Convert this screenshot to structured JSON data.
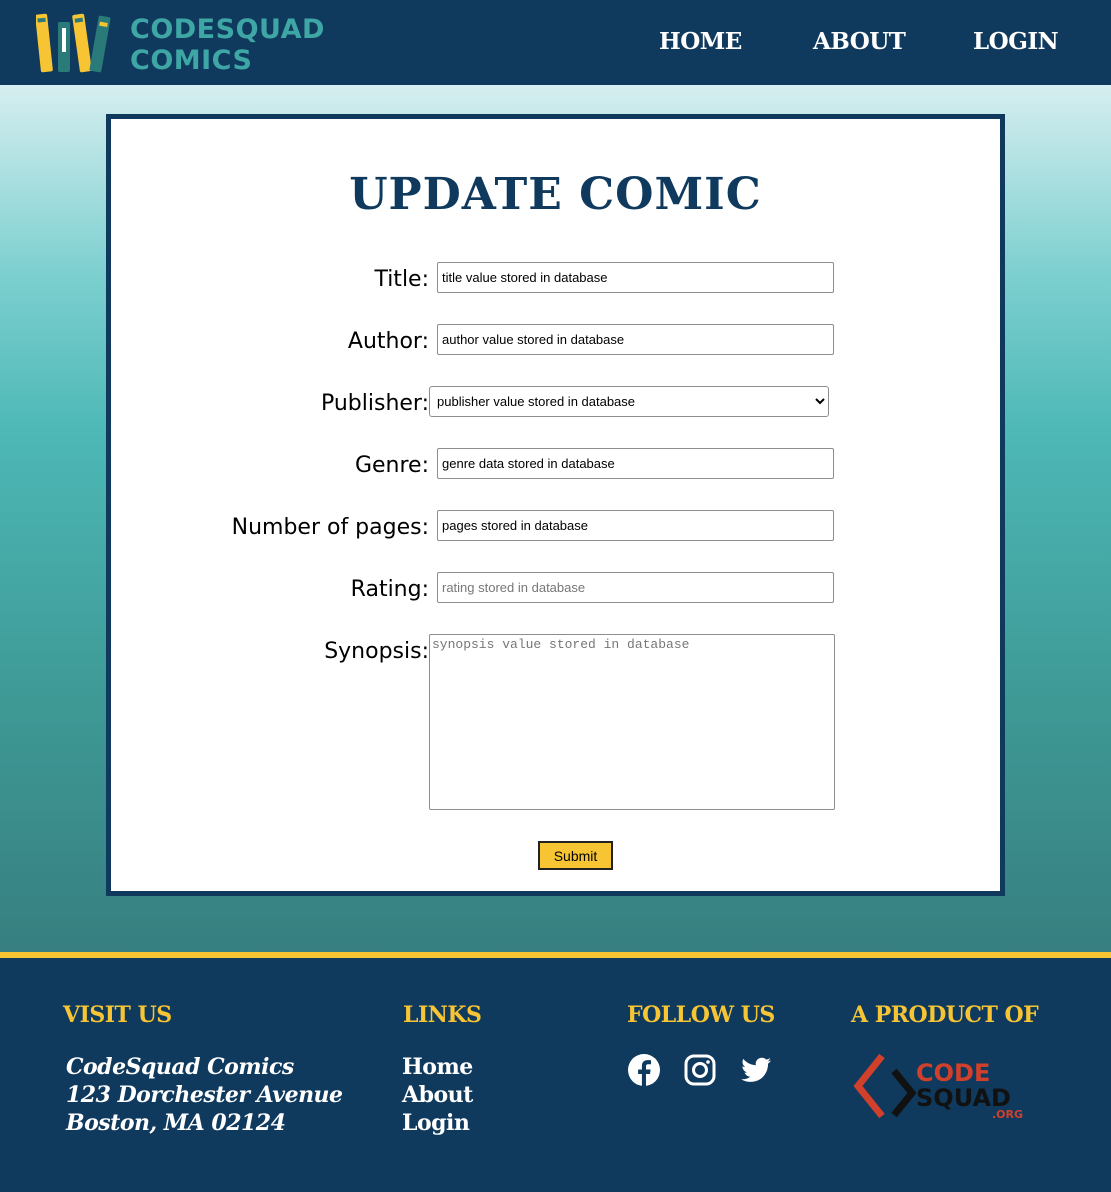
{
  "header": {
    "brand_line1": "CODESQUAD",
    "brand_line2": "COMICS",
    "nav": {
      "home": "HOME",
      "about": "ABOUT",
      "login": "LOGIN"
    }
  },
  "form": {
    "title": "UPDATE COMIC",
    "fields": {
      "title": {
        "label": "Title:",
        "value": "title value stored in database"
      },
      "author": {
        "label": "Author:",
        "value": "author value stored in database"
      },
      "publisher": {
        "label": "Publisher:",
        "selected": "publisher value stored in database"
      },
      "genre": {
        "label": "Genre:",
        "value": "genre data stored in database"
      },
      "pages": {
        "label": "Number of pages:",
        "value": "pages stored in database"
      },
      "rating": {
        "label": "Rating:",
        "placeholder": "rating stored in database"
      },
      "synopsis": {
        "label": "Synopsis:",
        "placeholder": "synopsis value stored in database"
      }
    },
    "submit_label": "Submit"
  },
  "footer": {
    "visit": {
      "heading": "VISIT US",
      "line1": "CodeSquad Comics",
      "line2": "123 Dorchester Avenue",
      "line3": "Boston, MA 02124"
    },
    "links": {
      "heading": "LINKS",
      "home": "Home",
      "about": "About",
      "login": "Login"
    },
    "follow": {
      "heading": "FOLLOW US",
      "icons": [
        "facebook-icon",
        "instagram-icon",
        "twitter-icon"
      ]
    },
    "product": {
      "heading": "A PRODUCT OF",
      "logo_text1": "CODE",
      "logo_text2": "SQUAD",
      "logo_text3": ".ORG"
    }
  },
  "colors": {
    "navy": "#0f3a5e",
    "teal": "#3fa6a6",
    "yellow": "#f7c533",
    "codesquad_red": "#d0402b"
  }
}
